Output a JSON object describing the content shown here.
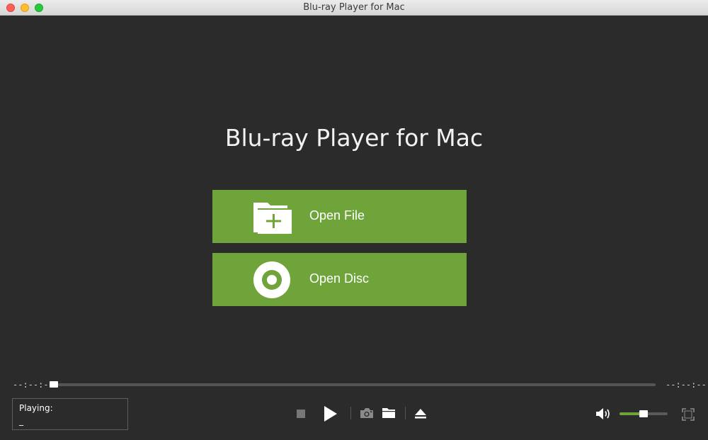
{
  "window": {
    "title": "Blu-ray Player for Mac"
  },
  "main": {
    "app_title": "Blu-ray Player for Mac",
    "open_file_label": "Open File",
    "open_disc_label": "Open Disc"
  },
  "player": {
    "time_elapsed": "--:--:--",
    "time_total": "--:--:--",
    "progress": 0,
    "playing_label": "Playing:",
    "playing_value": "_",
    "volume": 0.5
  },
  "icons": {
    "open_file": "folder-plus-icon",
    "open_disc": "disc-icon",
    "stop": "stop-icon",
    "play": "play-icon",
    "snapshot": "camera-icon",
    "folder": "folder-icon",
    "eject": "eject-icon",
    "volume": "speaker-icon",
    "fullscreen": "fullscreen-icon"
  },
  "colors": {
    "accent": "#6fa43a",
    "background": "#2b2b2b"
  }
}
